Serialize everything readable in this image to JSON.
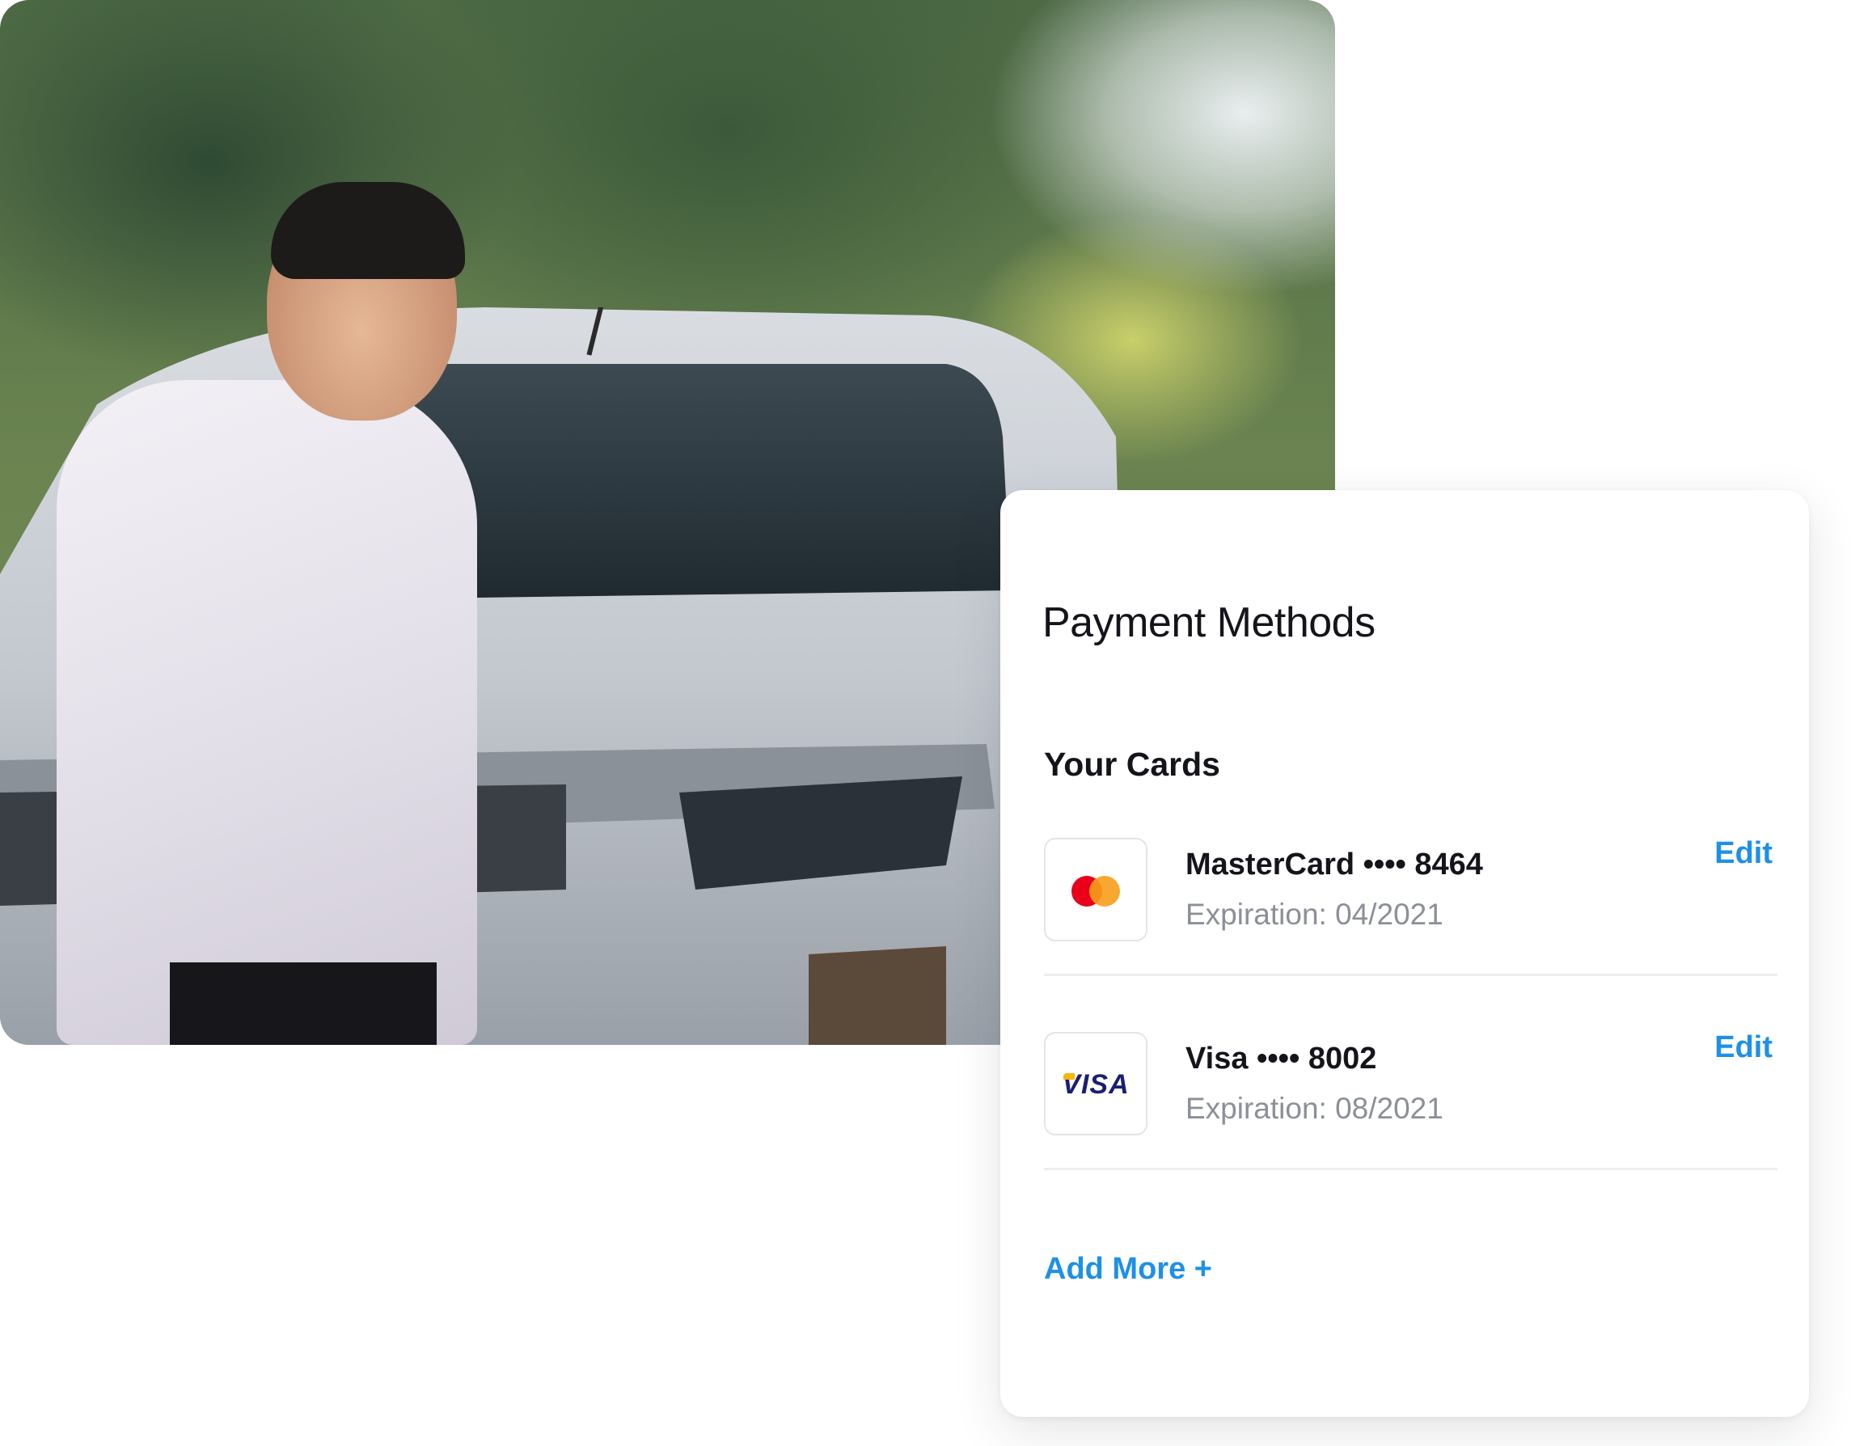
{
  "payment": {
    "title": "Payment Methods",
    "section_label": "Your Cards",
    "cards": [
      {
        "brand_icon": "mastercard-icon",
        "name": "MasterCard •••• 8464",
        "expiration": "Expiration: 04/2021",
        "edit_label": "Edit"
      },
      {
        "brand_icon": "visa-icon",
        "brand_logo_text": "VISA",
        "name": "Visa •••• 8002",
        "expiration": "Expiration: 08/2021",
        "edit_label": "Edit"
      }
    ],
    "add_more_label": "Add More +"
  },
  "colors": {
    "link": "#1e90e6",
    "text_primary": "#14151a",
    "text_secondary": "#8b8f98",
    "mastercard_red": "#eb001b",
    "mastercard_orange": "#f79e1b",
    "visa_blue": "#1a1f71"
  }
}
